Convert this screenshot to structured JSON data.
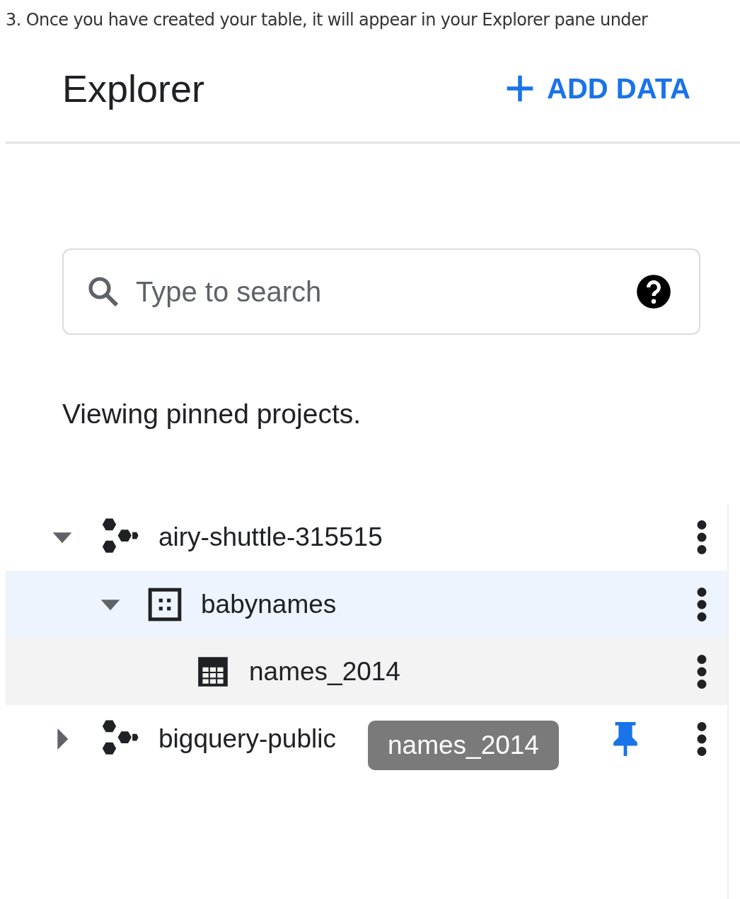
{
  "intro": "3. Once you have created your table, it will appear in your Explorer pane under",
  "header": {
    "title": "Explorer",
    "add_button": "ADD DATA"
  },
  "search": {
    "placeholder": "Type to search"
  },
  "notice": "Viewing pinned projects.",
  "tree": [
    {
      "kind": "project",
      "label": "airy-shuttle-315515",
      "expanded": true,
      "selected": false,
      "hovered": false,
      "children": [
        {
          "kind": "dataset",
          "label": "babynames",
          "expanded": true,
          "selected": true,
          "hovered": false,
          "children": [
            {
              "kind": "table",
              "label": "names_2014",
              "selected": false,
              "hovered": true
            }
          ]
        }
      ]
    },
    {
      "kind": "project",
      "label": "bigquery-public",
      "expanded": false,
      "selected": false,
      "hovered": false,
      "pinned": true,
      "tooltip": "names_2014"
    }
  ]
}
